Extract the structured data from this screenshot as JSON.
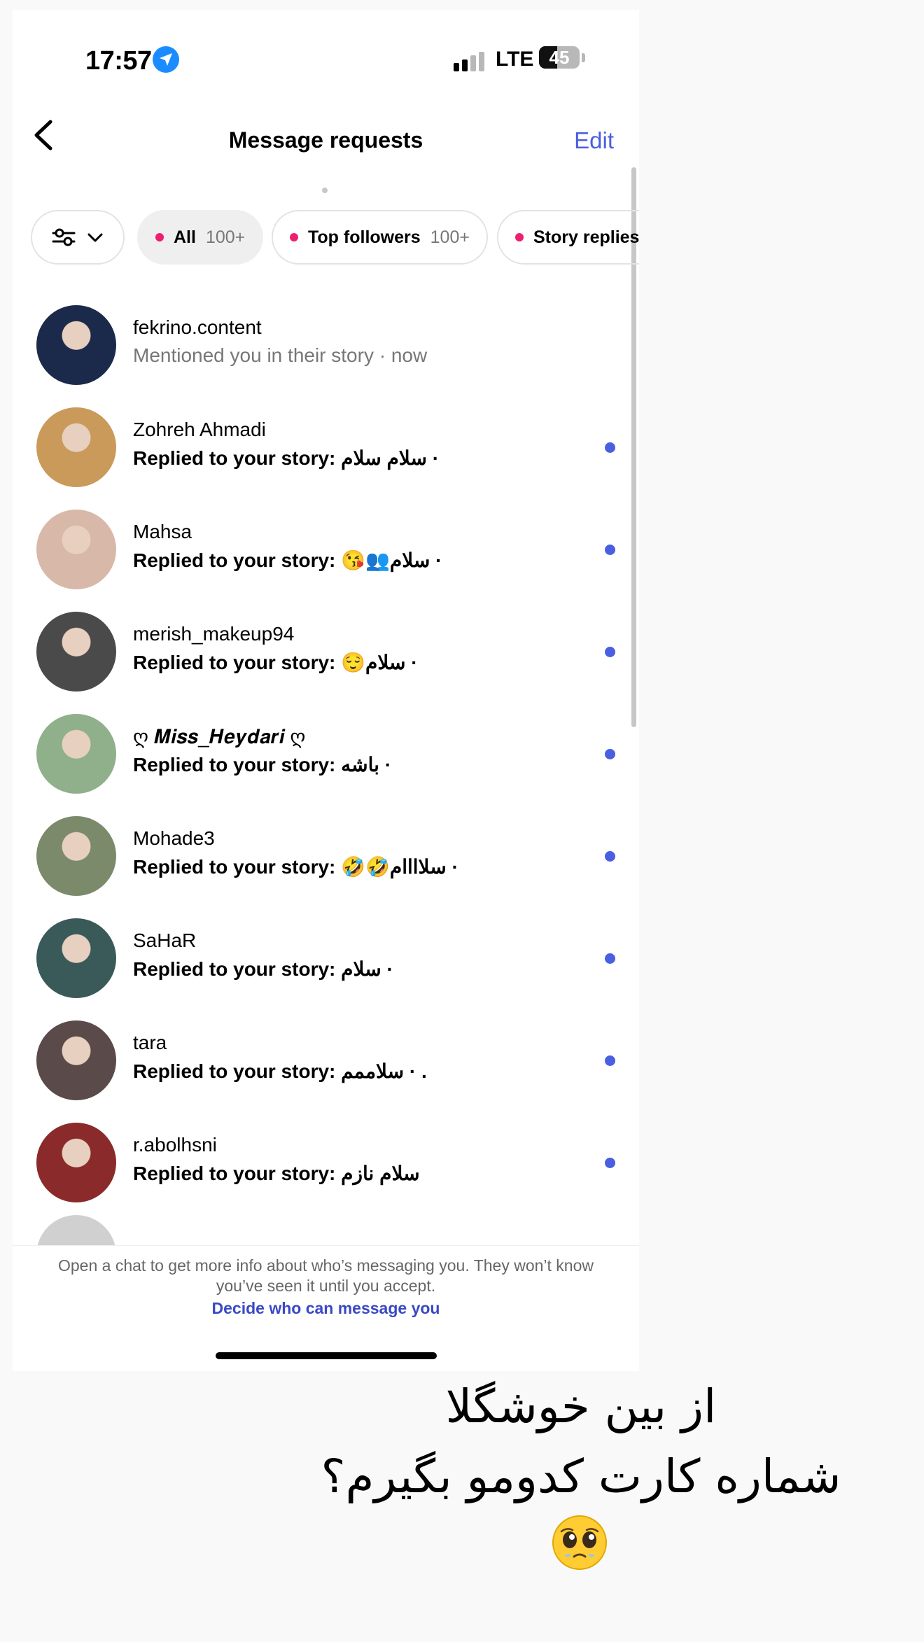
{
  "status_bar": {
    "time": "17:57",
    "network": "LTE",
    "battery": "45",
    "battery_level": 0.45
  },
  "header": {
    "title": "Message requests",
    "edit_label": "Edit"
  },
  "filters": {
    "chips": [
      {
        "label": "All",
        "count": "100+",
        "active": true
      },
      {
        "label": "Top followers",
        "count": "100+",
        "active": false
      },
      {
        "label": "Story replies",
        "count": "",
        "active": false
      }
    ]
  },
  "requests": [
    {
      "username": "fekrino.content",
      "preview": "Mentioned you in their story · now",
      "unread": false,
      "avatar_color": "#1b2a4a"
    },
    {
      "username": "Zohreh Ahmadi",
      "preview": "Replied to your story: سلام سلام ·",
      "unread": true,
      "avatar_color": "#c99a5a"
    },
    {
      "username": "Mahsa",
      "preview": "Replied to your story: 😘👥سلام ·",
      "unread": true,
      "avatar_color": "#d8b8a8"
    },
    {
      "username": "merish_makeup94",
      "preview": "Replied to your story: 😌سلام ·",
      "unread": true,
      "avatar_color": "#4a4a4a"
    },
    {
      "username": "ღ 𝑴𝒊𝒔𝒔_𝑯𝒆𝒚𝒅𝒂𝒓𝒊 ღ",
      "preview": "Replied to your story: باشه ·",
      "unread": true,
      "avatar_color": "#8fb08a"
    },
    {
      "username": "Mohade3",
      "preview": "Replied to your story: 🤣🤣سلاااام ·",
      "unread": true,
      "avatar_color": "#7a8a6a"
    },
    {
      "username": "SaHaR",
      "preview": "Replied to your story: سلام ·",
      "unread": true,
      "avatar_color": "#3a5a5a"
    },
    {
      "username": "tara",
      "preview": "Replied to your story: سلاممم · .",
      "unread": true,
      "avatar_color": "#5a4a4a"
    },
    {
      "username": "r.abolhsni",
      "preview": "Replied to your story: سلام نازم",
      "unread": true,
      "avatar_color": "#8a2a2a"
    }
  ],
  "footer": {
    "note": "Open a chat to get more info about who’s messaging you. They won’t know you’ve seen it until you accept.",
    "link": "Decide who can message you"
  },
  "caption": {
    "line1": "از بین خوشگلا",
    "line2": "شماره کارت کدومو بگیرم؟",
    "emoji": "🥹"
  },
  "colors": {
    "accent": "#4a5fe0",
    "unread_dot": "#4a5fe0",
    "chip_dot": "#ee1f6e",
    "link": "#3949c4"
  }
}
